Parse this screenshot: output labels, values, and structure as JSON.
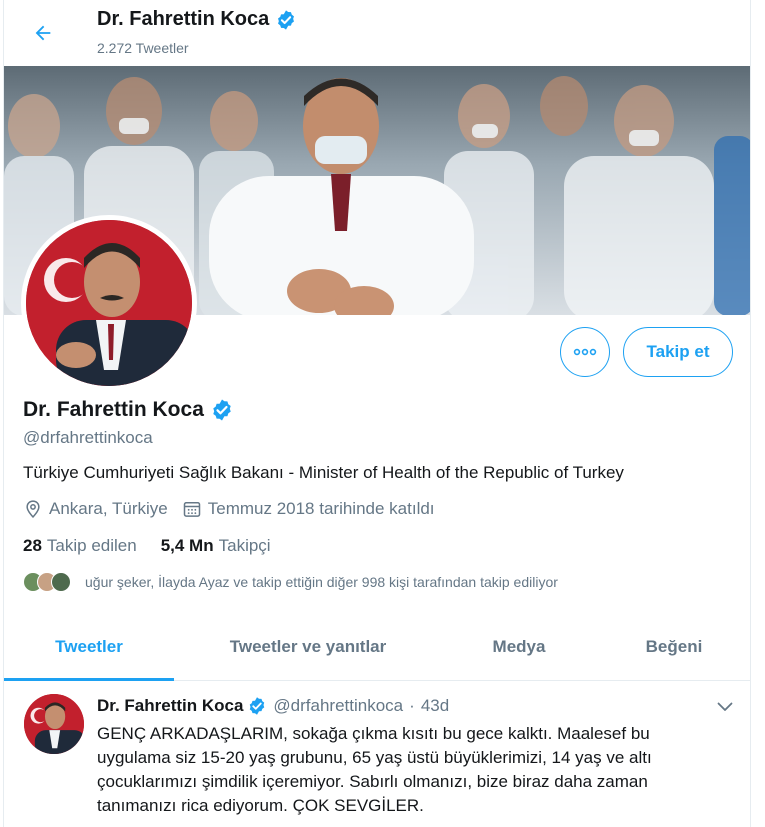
{
  "header": {
    "name": "Dr. Fahrettin Koca",
    "tweet_count": "2.272 Tweetler"
  },
  "profile": {
    "name": "Dr. Fahrettin Koca",
    "handle": "@drfahrettinkoca",
    "bio": "Türkiye Cumhuriyeti Sağlık Bakanı - Minister of Health of the Republic of Turkey",
    "location": "Ankara, Türkiye",
    "joined": "Temmuz 2018 tarihinde katıldı",
    "following_count": "28",
    "following_label": "Takip edilen",
    "followers_count": "5,4 Mn",
    "followers_label": "Takipçi",
    "followed_by": "uğur şeker, İlayda Ayaz ve takip ettiğin diğer 998 kişi tarafından takip ediliyor",
    "follow_button": "Takip et",
    "verified": true
  },
  "tabs": [
    {
      "label": "Tweetler",
      "active": true
    },
    {
      "label": "Tweetler ve yanıtlar",
      "active": false
    },
    {
      "label": "Medya",
      "active": false
    },
    {
      "label": "Beğeni",
      "active": false
    }
  ],
  "tweet": {
    "name": "Dr. Fahrettin Koca",
    "handle": "@drfahrettinkoca",
    "separator": "·",
    "time": "43d",
    "text": "GENÇ ARKADAŞLARIM, sokağa çıkma kısıtı bu gece kalktı. Maalesef bu uygulama siz 15-20 yaş grubunu, 65 yaş üstü büyüklerimizi, 14 yaş ve altı çocuklarımızı şimdilik içeremiyor. Sabırlı olmanızı, bize biraz daha zaman tanımanızı rica ediyorum. ÇOK SEVGİLER."
  },
  "colors": {
    "accent": "#1da1f2",
    "text": "#14171a",
    "muted": "#657786",
    "border": "#e6ecf0"
  },
  "icons": {
    "back": "arrow-left-icon",
    "verified": "verified-badge-icon",
    "location": "location-pin-icon",
    "calendar": "calendar-icon",
    "more": "more-dots-icon",
    "chevron": "chevron-down-icon"
  }
}
